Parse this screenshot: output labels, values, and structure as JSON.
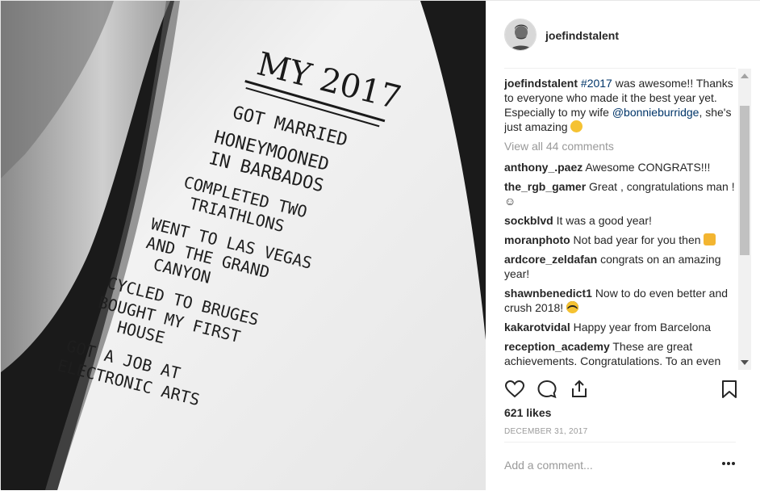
{
  "post": {
    "username": "joefindstalent",
    "avatar_icon": "profile-avatar",
    "notebook_text": {
      "title": "MY 2017",
      "lines": [
        "GOT MARRIED",
        "HONEYMOONED",
        "IN BARBADOS",
        "COMPLETED TWO",
        "TRIATHLONS",
        "WENT TO LAS VEGAS",
        "AND THE GRAND",
        "CANYON",
        "CYCLED TO BRUGES",
        "BOUGHT MY FIRST",
        "HOUSE",
        "GOT A JOB AT",
        "ELECTRONIC ARTS"
      ]
    }
  },
  "caption": {
    "user": "joefindstalent",
    "hashtag": "#2017",
    "text_1": " was awesome!! Thanks to everyone who made it the best year yet. Especially to my wife ",
    "mention": "@bonnieburridge",
    "text_2": ", she's just amazing"
  },
  "view_all": "View all 44 comments",
  "comments": [
    {
      "user": "anthony_.paez",
      "text": "Awesome CONGRATS!!!"
    },
    {
      "user": "the_rgb_gamer",
      "text": "Great , congratulations man ! ☺"
    },
    {
      "user": "sockblvd",
      "text": "It was a good year!"
    },
    {
      "user": "moranphoto",
      "text": "Not bad year for you then",
      "emoji": "thumbs-up-emoji"
    },
    {
      "user": "ardcore_zeldafan",
      "text": "congrats on an amazing year!"
    },
    {
      "user": "shawnbenedict1",
      "text": "Now to do even better and crush 2018!",
      "emoji": "sunglasses-emoji"
    },
    {
      "user": "kakarotvidal",
      "text": "Happy year from Barcelona"
    },
    {
      "user": "reception_academy",
      "text": "These are great achievements. Congratulations. To an even"
    }
  ],
  "likes": "621 likes",
  "date": "DECEMBER 31, 2017",
  "add_comment_placeholder": "Add a comment...",
  "icons": {
    "like": "heart-icon",
    "comment": "comment-icon",
    "share": "share-icon",
    "save": "bookmark-icon",
    "more": "more-options-icon"
  },
  "colors": {
    "link": "#003569",
    "muted": "#999999",
    "text": "#262626"
  }
}
